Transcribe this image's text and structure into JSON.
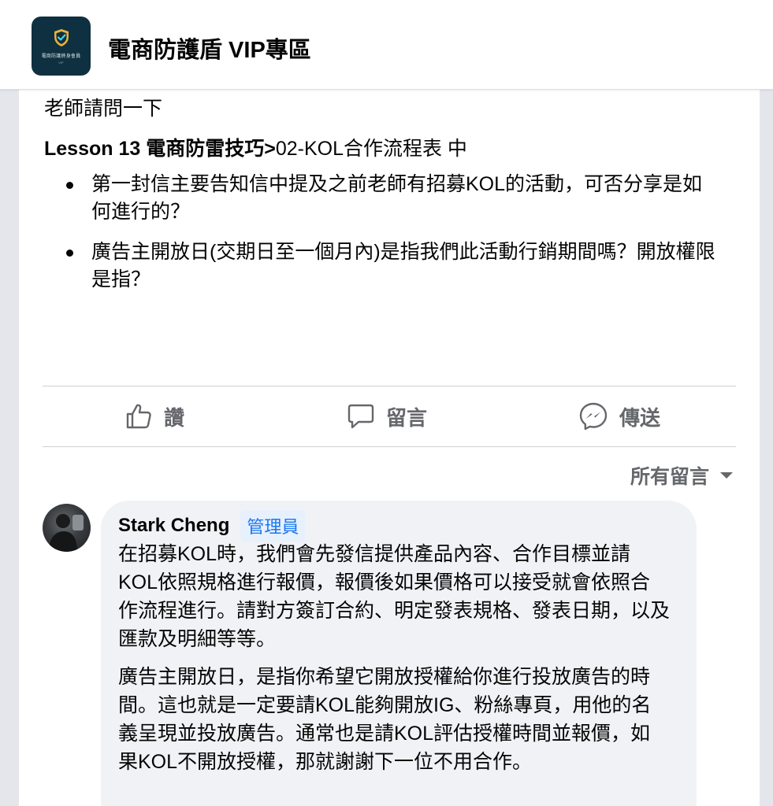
{
  "header": {
    "group_title": "電商防護盾 VIP專區",
    "logo_text": "電商防護終身會員",
    "logo_sub": "VIP"
  },
  "post": {
    "intro": "老師請問一下",
    "lesson_bold": "Lesson 13 電商防雷技巧>",
    "lesson_rest": "02-KOL合作流程表 中",
    "bullets": [
      "第一封信主要告知信中提及之前老師有招募KOL的活動，可否分享是如何進行的？",
      "廣告主開放日(交期日至一個月內)是指我們此活動行銷期間嗎？開放權限是指？"
    ]
  },
  "actions": {
    "like_label": "讚",
    "comment_label": "留言",
    "share_label": "傳送"
  },
  "comments_sort": {
    "label": "所有留言"
  },
  "comment": {
    "author": "Stark Cheng",
    "badge": "管理員",
    "paragraphs": [
      "在招募KOL時，我們會先發信提供產品內容、合作目標並請KOL依照規格進行報價，報價後如果價格可以接受就會依照合作流程進行。請對方簽訂合約、明定發表規格、發表日期，以及匯款及明細等等。",
      "廣告主開放日，是指你希望它開放授權給你進行投放廣告的時間。這也就是一定要請KOL能夠開放IG、粉絲專頁，用他的名義呈現並投放廣告。通常也是請KOL評估授權時間並報價，如果KOL不開放授權，那就謝謝下一位不用合作。"
    ]
  },
  "colors": {
    "accent": "#1877f2",
    "secondary_text": "#65676b",
    "bubble_bg": "#f0f2f5",
    "logo_bg": "#0f3040"
  },
  "icons": {
    "like": "thumbs-up-icon",
    "comment": "speech-bubble-icon",
    "share": "messenger-icon",
    "sort": "caret-down-icon",
    "logo": "shield-check-icon"
  }
}
